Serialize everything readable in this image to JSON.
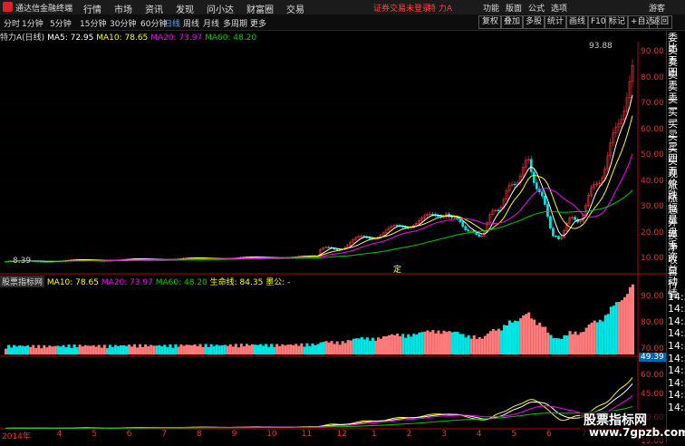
{
  "app": {
    "name": "通达信金融终端"
  },
  "menu": [
    "行情",
    "市场",
    "资讯",
    "发现",
    "问小达",
    "财富圈",
    "交易"
  ],
  "warning": "证券交易未登录",
  "stock_title": "特 力A",
  "menu_right": [
    "功能",
    "版面",
    "公式",
    "选项",
    "游客"
  ],
  "periods": [
    "分时",
    "1分钟",
    "5分钟",
    "15分钟",
    "30分钟",
    "60分钟",
    "日线",
    "周线",
    "月线",
    "多周期",
    "更多"
  ],
  "active_period": "日线",
  "toolbar_right": [
    "复权",
    "叠加",
    "多股",
    "统计",
    "画线",
    "F10",
    "标记",
    "+自选",
    "返回"
  ],
  "ma_line": {
    "label": "特力A(日线)",
    "ma5": "MA5: 72.95",
    "ma10": "MA10: 78.65",
    "ma20": "MA20: 73.97",
    "ma60": "MA60: 48.20"
  },
  "indicator_line": {
    "source": "股票指标网",
    "ma10": "MA10: 78.65",
    "ma20": "MA20: 73.97",
    "ma60": "MA60: 48.20",
    "life": "生命线: 84.35",
    "mogong": "墨公: -"
  },
  "price_axis": [
    "90.00",
    "80.00",
    "70.00",
    "60.00",
    "50.00",
    "40.00",
    "30.00",
    "20.00",
    "10.00"
  ],
  "high_label": "93.88",
  "low_label": "8.39",
  "ding": "定",
  "vol_axis": [
    "90.00",
    "80.00",
    "70.00",
    "60.00"
  ],
  "vol_value": "49.39",
  "ind_axis": [
    "45.00",
    "30.00",
    "15.00"
  ],
  "dates": [
    "2014年",
    "4",
    "5",
    "6",
    "7",
    "8",
    "9",
    "10",
    "11",
    "12",
    "1",
    "2",
    "3",
    "4",
    "5",
    "6",
    "7",
    "8",
    "9"
  ],
  "side_quote": [
    "委比",
    "卖五",
    "卖四",
    "卖三",
    "卖二",
    "卖一",
    "买一",
    "买二",
    "买三",
    "买四",
    "买五",
    "现价",
    "涨跌",
    "涨幅",
    "总量",
    "外盘",
    "换手",
    "净资",
    "收益",
    "自动",
    "行情",
    "14:5",
    "14:5",
    "14:5",
    "14:5",
    "14:5",
    "14:5",
    "14:5",
    "14:5",
    "14:5",
    "14:5"
  ],
  "watermark": {
    "line1": "股票指标网",
    "line2": "www.7gpzb.com"
  },
  "colors": {
    "up": "#ff3c3c",
    "down": "#00e5e5",
    "ma5": "#ffffff",
    "ma10": "#ffff00",
    "ma20": "#ff00ff",
    "ma60": "#00cc00"
  }
}
